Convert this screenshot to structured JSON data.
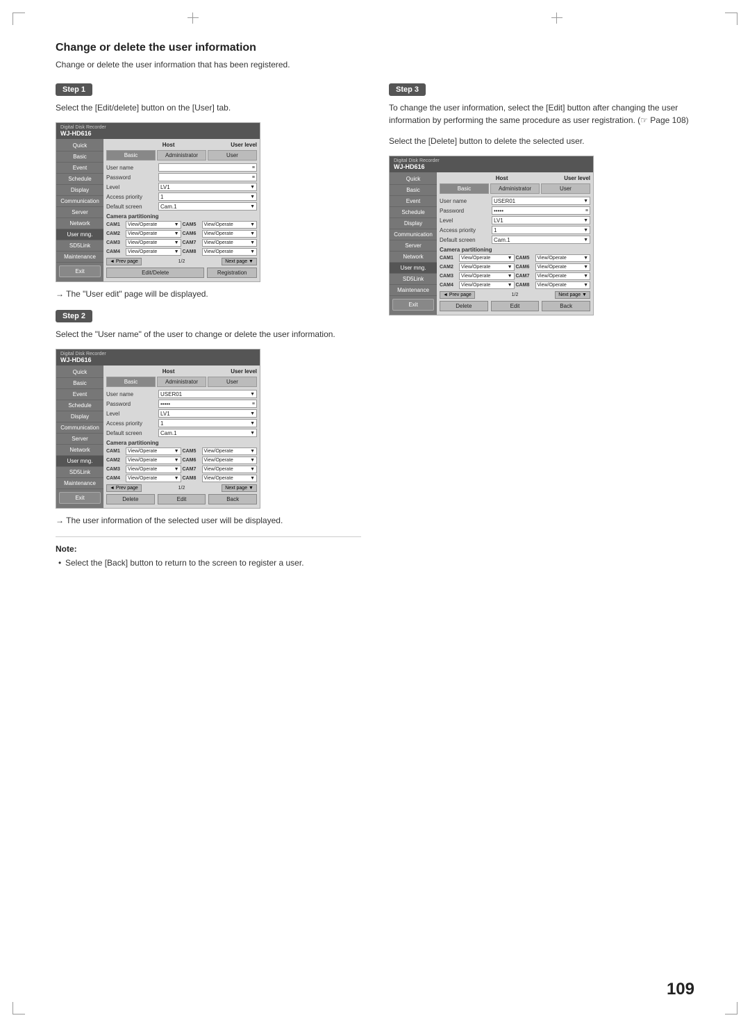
{
  "page": {
    "number": "109",
    "title": "Change or delete the user information",
    "intro": "Change or delete the user information that has been registered."
  },
  "steps": {
    "step1": {
      "badge": "Step 1",
      "text": "Select the [Edit/delete] button on the [User] tab.",
      "arrow": "→ The \"User edit\" page will be displayed."
    },
    "step2": {
      "badge": "Step 2",
      "text": "Select the \"User name\" of the user to change or delete the user information.",
      "arrow": "→ The user information of the selected user will be displayed."
    },
    "step3": {
      "badge": "Step 3",
      "text1": "To change the user information, select the [Edit] button after changing the user information by performing the same procedure as user registration. (☞ Page 108)",
      "text2": "Select the [Delete] button to delete the selected user."
    }
  },
  "note": {
    "title": "Note:",
    "bullet": "Select the [Back] button to return to the screen to register a user."
  },
  "recorder": {
    "brand": "Digital Disk Recorder",
    "model": "WJ-HD616",
    "host_label": "Host",
    "user_level_label": "User level",
    "tabs": [
      "Basic",
      "Administrator",
      "User"
    ],
    "menu_items": [
      "Quick",
      "Basic",
      "Event",
      "Schedule",
      "Display",
      "Communication",
      "Server",
      "Network",
      "User mng.",
      "SD5Link",
      "Maintenance"
    ],
    "exit_btn": "Exit",
    "form_fields": {
      "user_name": "User name",
      "password": "Password",
      "level": "Level",
      "access_priority": "Access priority",
      "default_screen": "Default screen"
    },
    "form_values_empty": {
      "user_name": "",
      "password": "",
      "level": "LV1",
      "access_priority": "1",
      "default_screen": "Cam.1"
    },
    "form_values_filled": {
      "user_name": "USER01",
      "password": "•••••",
      "level": "LV1",
      "access_priority": "1",
      "default_screen": "Cam.1"
    },
    "camera_section": "Camera partitioning",
    "cameras_left": [
      "CAM1",
      "CAM2",
      "CAM3",
      "CAM4"
    ],
    "cameras_right": [
      "CAM5",
      "CAM6",
      "CAM7",
      "CAM8"
    ],
    "cam_value": "View/Operate",
    "prev_btn": "◄ Prev page",
    "page_indicator": "1/2",
    "next_btn": "Next page ▼",
    "buttons_step1": {
      "edit_delete": "Edit/Delete",
      "registration": "Registration"
    },
    "buttons_step2_3": {
      "delete": "Delete",
      "edit": "Edit",
      "back": "Back"
    }
  }
}
